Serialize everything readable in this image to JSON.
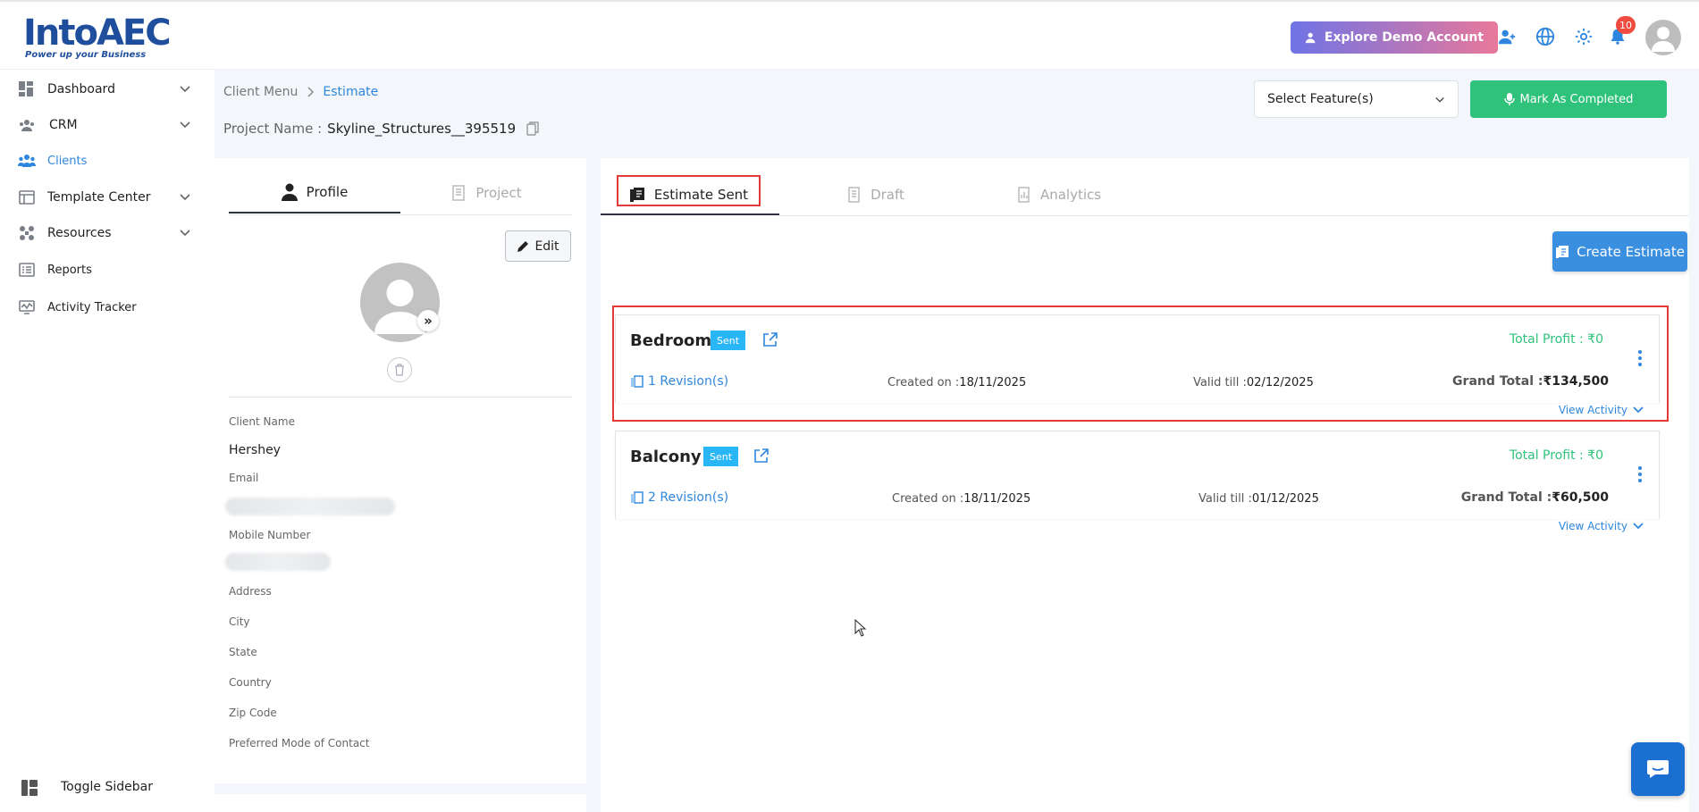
{
  "brand": {
    "name": "IntoAEC",
    "tagline": "Power up your Business",
    "colors": {
      "primary": "#1f4e9c",
      "accent": "#2e86de",
      "success": "#2fc27a",
      "badge": "#29b6f6",
      "highlight": "#e53935"
    }
  },
  "header": {
    "demo_button": "Explore Demo Account",
    "icons": [
      "add-user-icon",
      "globe-icon",
      "gear-icon",
      "bell-icon",
      "user-avatar"
    ],
    "notification_count": "10"
  },
  "sidebar": {
    "items": [
      {
        "label": "Dashboard",
        "icon": "dashboard-icon",
        "expandable": true
      },
      {
        "label": "CRM",
        "icon": "crm-icon",
        "expandable": true
      },
      {
        "label": "Clients",
        "icon": "clients-icon",
        "expandable": false,
        "active": true
      },
      {
        "label": "Template Center",
        "icon": "template-icon",
        "expandable": true
      },
      {
        "label": "Resources",
        "icon": "resources-icon",
        "expandable": true
      },
      {
        "label": "Reports",
        "icon": "reports-icon",
        "expandable": false
      },
      {
        "label": "Activity Tracker",
        "icon": "activity-icon",
        "expandable": false
      }
    ],
    "toggle_label": "Toggle Sidebar"
  },
  "breadcrumb": {
    "root": "Client Menu",
    "current": "Estimate"
  },
  "project": {
    "label": "Project Name :",
    "value": "Skyline_Structures__395519"
  },
  "toolbar": {
    "select_placeholder": "Select Feature(s)",
    "mark_completed": "Mark As Completed"
  },
  "profile": {
    "tabs": [
      "Profile",
      "Project"
    ],
    "edit_label": "Edit",
    "fields": {
      "client_name_label": "Client Name",
      "client_name_value": "Hershey",
      "email_label": "Email",
      "mobile_label": "Mobile Number",
      "address_label": "Address",
      "city_label": "City",
      "state_label": "State",
      "country_label": "Country",
      "zip_label": "Zip Code",
      "contact_label": "Preferred Mode of Contact"
    }
  },
  "estimates": {
    "tabs": [
      "Estimate Sent",
      "Draft",
      "Analytics"
    ],
    "create_label": "Create Estimate",
    "items": [
      {
        "name": "Bedroom",
        "status": "Sent",
        "total_profit": "Total Profit : ₹0",
        "revisions": "1 Revision(s)",
        "created_label": "Created on :",
        "created": "18/11/2025",
        "valid_label": "Valid till :",
        "valid": "02/12/2025",
        "grand_label": "Grand Total :",
        "grand": "₹134,500",
        "activity": "View Activity"
      },
      {
        "name": "Balcony",
        "status": "Sent",
        "total_profit": "Total Profit : ₹0",
        "revisions": "2 Revision(s)",
        "created_label": "Created on :",
        "created": "18/11/2025",
        "valid_label": "Valid till :",
        "valid": "01/12/2025",
        "grand_label": "Grand Total :",
        "grand": "₹60,500",
        "activity": "View Activity"
      }
    ]
  }
}
